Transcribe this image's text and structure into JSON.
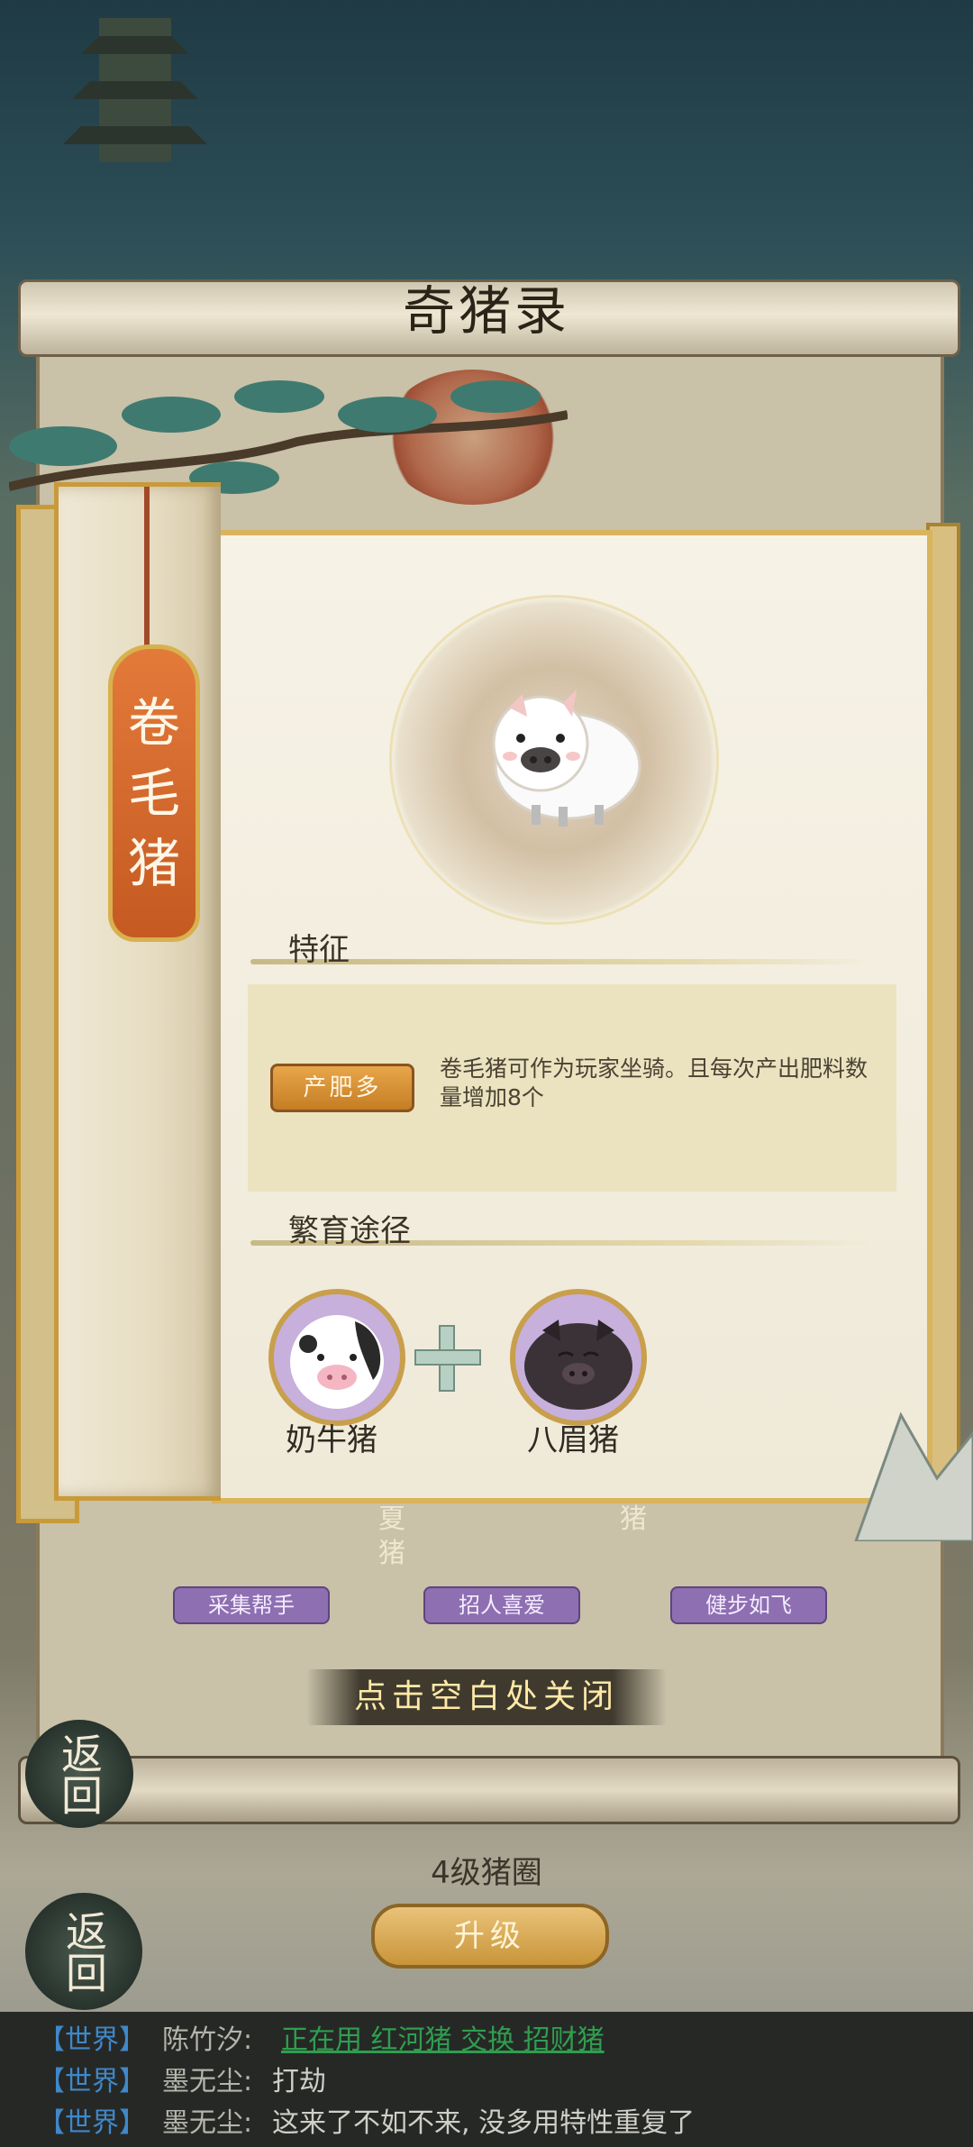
{
  "header": {
    "title": "奇猪录"
  },
  "pig": {
    "name_chars": [
      "卷",
      "毛",
      "猪"
    ],
    "portrait_icon": "curly-hair-pig-icon"
  },
  "traits": {
    "section_title": "特征",
    "tag": "产肥多",
    "description": "卷毛猪可作为玩家坐骑。且每次产出肥料数量增加8个"
  },
  "breeding": {
    "section_title": "繁育途径",
    "parents": [
      {
        "name": "奶牛猪",
        "icon": "cow-pig-icon"
      },
      {
        "name": "八眉猪",
        "icon": "black-pig-icon"
      }
    ],
    "plus_icon": "plus-icon"
  },
  "background_cards": {
    "tags": [
      "采集帮手",
      "招人喜爱",
      "健步如飞"
    ],
    "side_chars": [
      "夏",
      "猪",
      "猪"
    ]
  },
  "close_hint": "点击空白处关闭",
  "back_label": "返回",
  "pen": {
    "level_label": "4级猪圈",
    "upgrade_label": "升级"
  },
  "chat": [
    {
      "channel": "【世界】",
      "name": "陈竹汐:",
      "message": "正在用 红河猪 交换 招财猪",
      "is_link": true
    },
    {
      "channel": "【世界】",
      "name": "墨无尘:",
      "message": "打劫",
      "is_link": false
    },
    {
      "channel": "【世界】",
      "name": "墨无尘:",
      "message": "这来了不如不来, 没多用特性重复了",
      "is_link": false
    }
  ],
  "colors": {
    "name_tag": "#d2652b",
    "trait_tag": "#d98f35",
    "chat_channel": "#3f88c9",
    "chat_link": "#2f9e4f",
    "page_border": "#d9b45c"
  }
}
